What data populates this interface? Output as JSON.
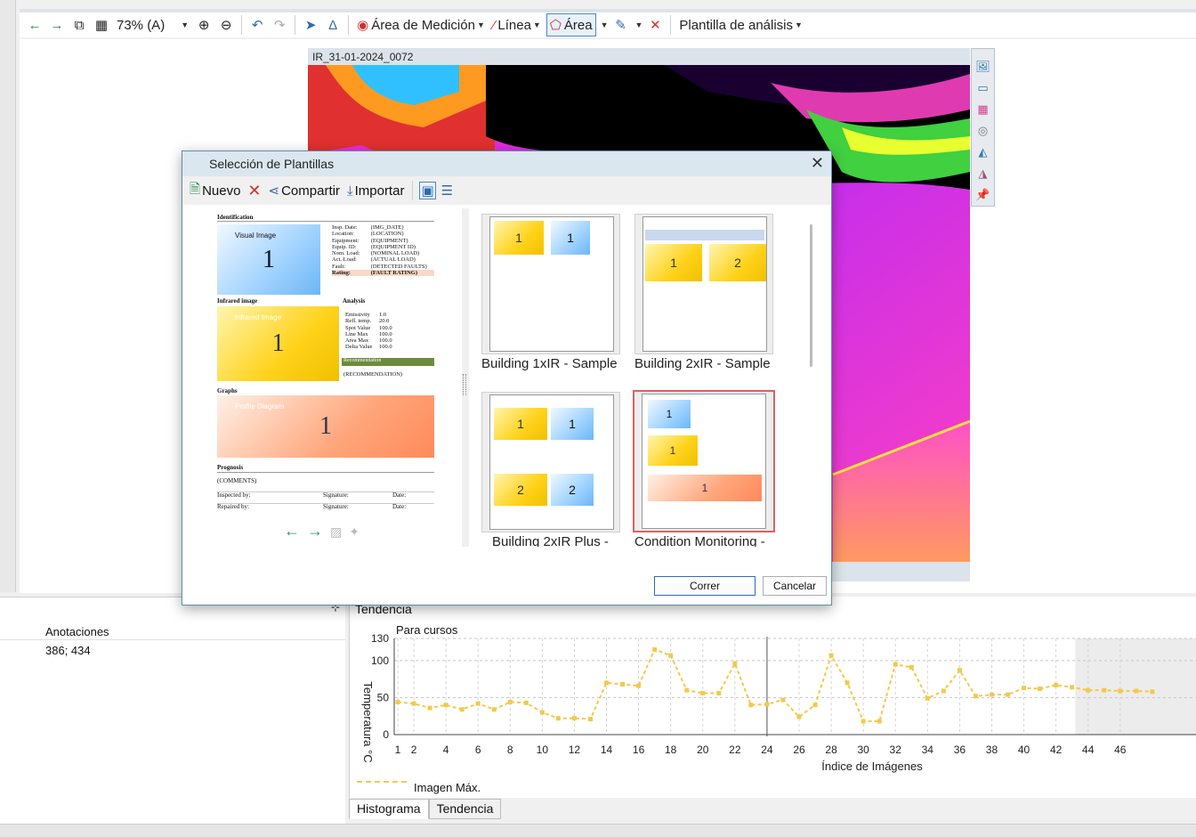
{
  "toolbar": {
    "zoom": "73% (A)",
    "area_medicion": "Área de Medición",
    "linea": "Línea",
    "area": "Área",
    "plantilla": "Plantilla de análisis"
  },
  "image_viewer": {
    "title": "IR_31-01-2024_0072"
  },
  "dialog": {
    "title": "Selección de Plantillas",
    "toolbar": {
      "nuevo": "Nuevo",
      "compartir": "Compartir",
      "importar": "Importar"
    },
    "templates": [
      {
        "label": "Building 1xIR - Sample",
        "selected": false
      },
      {
        "label": "Building 2xIR - Sample",
        "selected": false
      },
      {
        "label": "Building 2xIR Plus -",
        "selected": false
      },
      {
        "label": "Condition Monitoring -",
        "selected": true
      }
    ],
    "buttons": {
      "ok": "Correr",
      "cancel": "Cancelar"
    },
    "preview": {
      "identification": "Identification",
      "visual_image": "Visual Image",
      "infrared_image_hdr": "Infrared image",
      "infrared_image": "Infrared Image",
      "analysis": "Analysis",
      "graphs": "Graphs",
      "profile_diagram": "Profile Diagram",
      "prognosis": "Prognosis",
      "recommendation": "Recommendation",
      "recommendation_val": "(RECOMMENDATION)",
      "comments": "(COMMENTS)",
      "inspected_by": "Inspected by:",
      "repaired_by": "Repaired by:",
      "signature": "Signature:",
      "date": "Date:",
      "number_1": "1",
      "id_labels": [
        "Insp. Date:",
        "Location:",
        "Equipment:",
        "Equip. ID:",
        "Nom. Load:",
        "Act. Load:",
        "Fault:",
        "Rating:"
      ],
      "id_values": [
        "(IMG_DATE)",
        "(LOCATION)",
        "(EQUIPMENT)",
        "(EQUIPMENT ID)",
        "(NOMINAL LOAD)",
        "(ACTUAL LOAD)",
        "(DETECTED FAULTS)",
        "(FAULT RATING)"
      ],
      "analysis_labels": [
        "Emissivity",
        "Refl. temp.",
        "Spot Value",
        "Line Max",
        "Area Max",
        "Delta Value"
      ],
      "analysis_values": [
        "1.0",
        "20.0",
        "100.0",
        "100.0",
        "100.0",
        "100.0"
      ]
    }
  },
  "bottom_left": {
    "column": "Anotaciones",
    "value": "386; 434"
  },
  "trend_panel": {
    "title": "Tendencia",
    "subtitle": "Para cursos",
    "legend": "Imagen Máx.",
    "tabs": [
      "Histograma",
      "Tendencia"
    ]
  },
  "chart_data": {
    "type": "line",
    "xlabel": "Índice de Imágenes",
    "ylabel": "Temperatura °C",
    "xticks": [
      1,
      2,
      4,
      6,
      8,
      10,
      12,
      14,
      16,
      18,
      20,
      22,
      24,
      26,
      28,
      30,
      32,
      34,
      36,
      38,
      40,
      42,
      44,
      46
    ],
    "yticks": [
      0,
      50,
      100,
      130
    ],
    "ylim": [
      0,
      130
    ],
    "xlim": [
      1,
      48
    ],
    "grid": true,
    "series": [
      {
        "name": "Imagen Máx.",
        "color": "#f2c94c",
        "x": [
          1,
          2,
          3,
          4,
          5,
          6,
          7,
          8,
          9,
          10,
          11,
          12,
          13,
          14,
          15,
          16,
          17,
          18,
          19,
          20,
          21,
          22,
          23,
          24,
          25,
          26,
          27,
          28,
          29,
          30,
          31,
          32,
          33,
          34,
          35,
          36,
          37,
          38,
          39,
          40,
          41,
          42,
          43,
          44,
          45,
          46,
          47,
          48
        ],
        "values": [
          44,
          42,
          36,
          40,
          34,
          42,
          34,
          44,
          43,
          30,
          22,
          22,
          21,
          70,
          68,
          66,
          115,
          107,
          60,
          56,
          56,
          96,
          40,
          41,
          47,
          24,
          40,
          107,
          70,
          18,
          18,
          95,
          91,
          49,
          59,
          87,
          52,
          54,
          54,
          63,
          62,
          67,
          64,
          60,
          60,
          59,
          59,
          58
        ]
      }
    ]
  }
}
